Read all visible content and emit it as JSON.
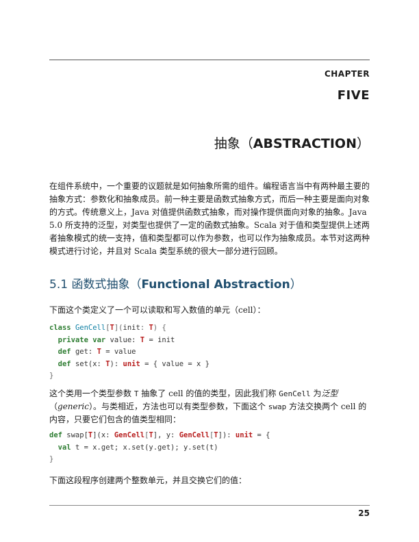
{
  "header": {
    "chapter_label": "CHAPTER",
    "chapter_number": "FIVE",
    "title_zh": "抽象（",
    "title_en": "ABSTRACTION",
    "title_close": "）"
  },
  "intro": {
    "s1": "在组件系统中，一个重要的议题就是如何抽象所需的组件。编程语言当中有两种最主要的抽象方式：参数化和抽象成员。前一种主要是函数式抽象方式，而后一种主要是面向对象的方式。传统意义上，",
    "java1": "Java",
    "s2": " 对值提供函数式抽象，而对操作提供面向对象的抽象。",
    "java2": "Java 5.0",
    "s3": " 所支持的泛型，对类型也提供了一定的函数式抽象。",
    "scala1": "Scala",
    "s4": " 对于值和类型提供上述两者抽象模式的统一支持，值和类型都可以作为参数，也可以作为抽象成员。本节对这两种模式进行讨论，并且对 ",
    "scala2": "Scala",
    "s5": " 类型系统的很大一部分进行回顾。"
  },
  "section": {
    "number": "5.1",
    "title_zh": "函数式抽象（",
    "title_en": "Functional Abstraction",
    "title_close": "）"
  },
  "para2": {
    "s1": "下面这个类定义了一个可以读取和写入数值的单元（",
    "cell": "cell",
    "s2": "）："
  },
  "code1": {
    "l1": [
      "class",
      " ",
      "GenCell",
      "[",
      "T",
      "](",
      "init",
      ": ",
      "T",
      ") {"
    ],
    "l2": [
      "  ",
      "private",
      " ",
      "var",
      " value: ",
      "T",
      " = init"
    ],
    "l3": [
      "  ",
      "def",
      " get: ",
      "T",
      " = value"
    ],
    "l4": [
      "  ",
      "def",
      " set(x: ",
      "T",
      "): ",
      "unit",
      " = { value = x }"
    ],
    "l5": "}"
  },
  "para3": {
    "s1": "这个类用一个类型参数 ",
    "t": "T",
    "s2": " 抽象了 ",
    "cell1": "cell",
    "s3": " 的值的类型，因此我们称 ",
    "gencell": "GenCell",
    "s4": " 为",
    "fanxing": "泛型",
    "s5": "（",
    "generic": "generic",
    "s6": "）。与类相近，方法也可以有类型参数，下面这个 ",
    "swap": "swap",
    "s7": " 方法交换两个 ",
    "cell2": "cell",
    "s8": " 的内容，只要它们包含的值类型相同："
  },
  "code2": {
    "l1": [
      "def",
      " swap[",
      "T",
      "](x: ",
      "GenCell",
      "[",
      "T",
      "], y: ",
      "GenCell",
      "[",
      "T",
      "]): ",
      "unit",
      " = {"
    ],
    "l2": [
      "  ",
      "val",
      " t = x.get; x.set(y.get); y.set(t)"
    ],
    "l3": "}"
  },
  "para4": {
    "s1": "下面这段程序创建两个整数单元，并且交换它们的值："
  },
  "footer": {
    "page_number": "25"
  }
}
